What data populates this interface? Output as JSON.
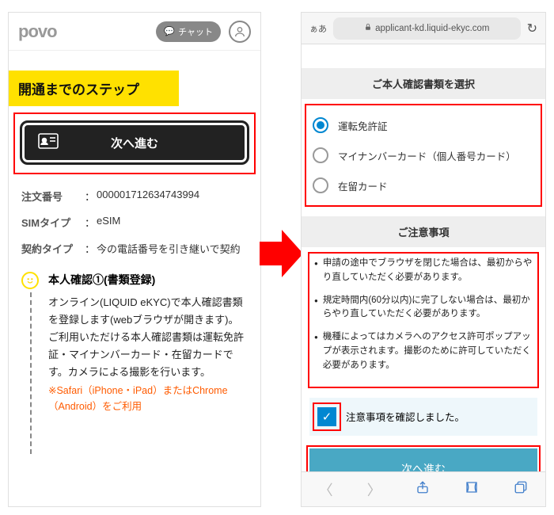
{
  "left": {
    "logo": "povo",
    "chat_label": "チャット",
    "step_banner": "開通までのステップ",
    "next_button": "次へ進む",
    "order": {
      "number_label": "注文番号",
      "number_value": "000001712634743994",
      "sim_label": "SIMタイプ",
      "sim_value": "eSIM",
      "contract_label": "契約タイプ",
      "contract_value": "今の電話番号を引き継いで契約"
    },
    "step1": {
      "title": "本人確認①(書類登録)",
      "body": "オンライン(LIQUID eKYC)で本人確認書類を登録します(webブラウザが開きます)。ご利用いただける本人確認書類は運転免許証・マイナンバーカード・在留カードです。カメラによる撮影を行います。",
      "warn": "※Safari（iPhone・iPad）またはChrome（Android）をご利用"
    }
  },
  "right": {
    "addr_aa": "ぁあ",
    "addr_url": "applicant-kd.liquid-ekyc.com",
    "sec1_title": "ご本人確認書類を選択",
    "radios": {
      "opt1": "運転免許証",
      "opt2": "マイナンバーカード（個人番号カード）",
      "opt3": "在留カード"
    },
    "sec2_title": "ご注意事項",
    "notes": {
      "n1": "申請の途中でブラウザを閉じた場合は、最初からやり直していただく必要があります。",
      "n2": "規定時間内(60分以内)に完了しない場合は、最初からやり直していただく必要があります。",
      "n3": "機種によってはカメラへのアクセス許可ポップアップが表示されます。撮影のために許可していただく必要があります。"
    },
    "confirm_label": "注意事項を確認しました。",
    "proceed": "次へ進む"
  }
}
